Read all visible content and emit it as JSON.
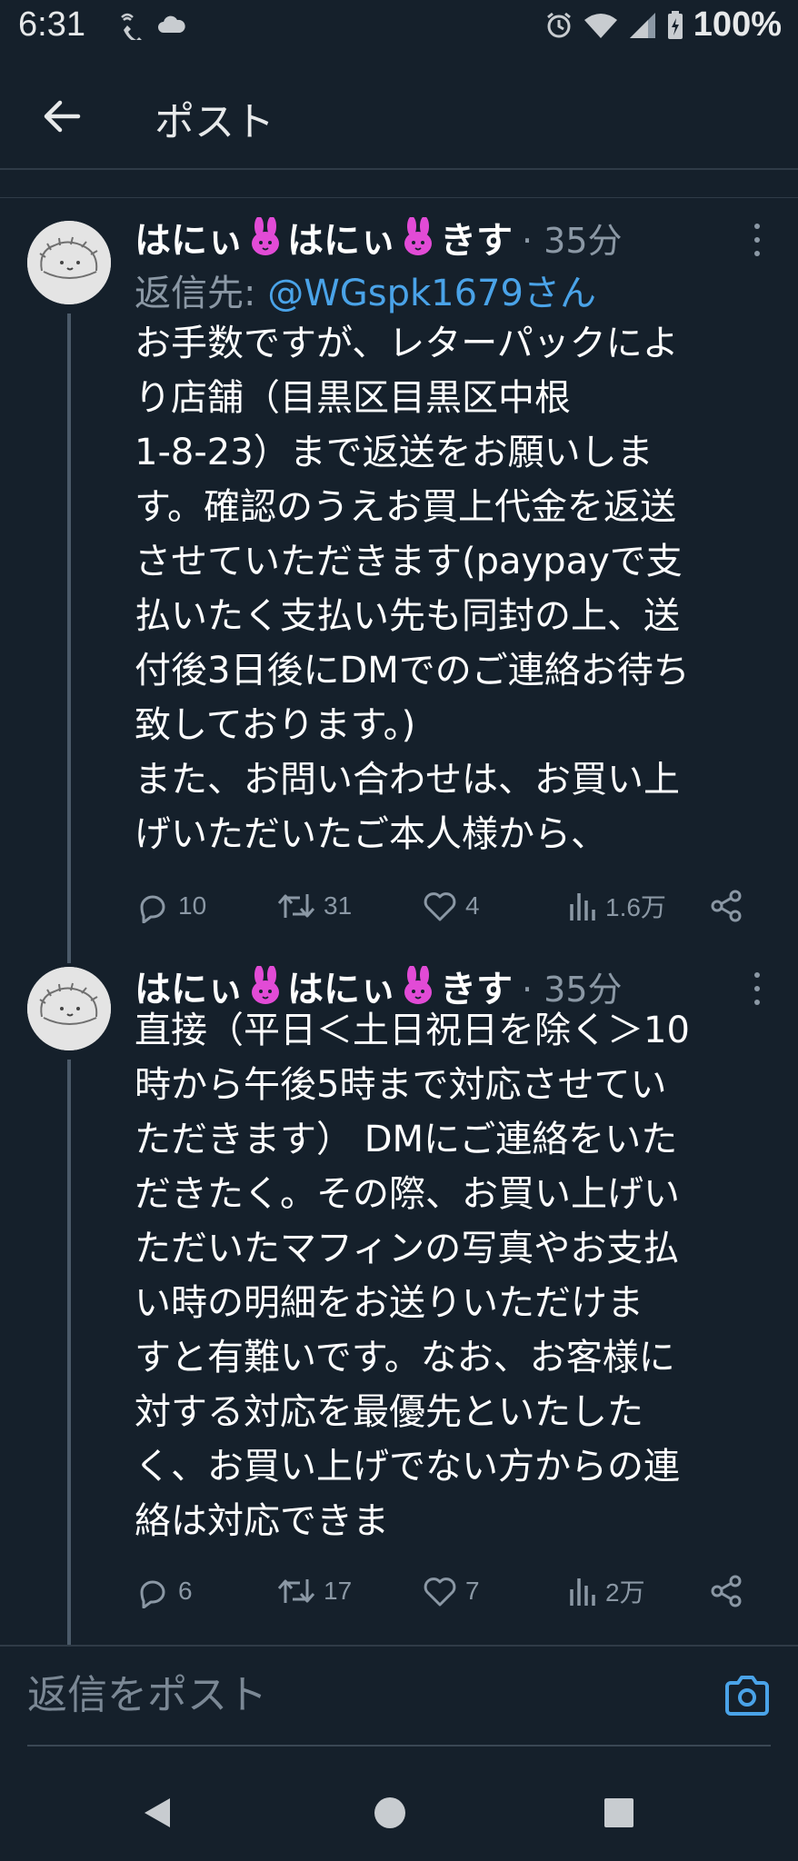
{
  "status_bar": {
    "time": "6:31",
    "battery": "100%",
    "icons": [
      "wifi-call-icon",
      "cloud-icon",
      "alarm-icon",
      "wifi-icon",
      "signal-icon",
      "battery-icon"
    ]
  },
  "header": {
    "title": "ポスト",
    "back_icon": "arrow-left-icon"
  },
  "tweets": [
    {
      "name_part1": "はにぃ",
      "name_part2": "はにぃ",
      "name_part3": "きす",
      "time": "· 35分",
      "reply_to_label": "返信先: ",
      "reply_to_handle": "@WGspk1679さん",
      "text": "お手数ですが、レターパックによ\nり店舗（目黒区目黒区中根\n1-8-23）まで返送をお願いしま\nす。確認のうえお買上代金を返送\nさせていただきます(paypayで支\n払いたく支払い先も同封の上、送\n付後3日後にDMでのご連絡お待ち\n致しております。)\nまた、お問い合わせは、お買い上\nげいただいたご本人様から、",
      "replies": "10",
      "retweets": "31",
      "likes": "4",
      "views": "1.6万"
    },
    {
      "name_part1": "はにぃ",
      "name_part2": "はにぃ",
      "name_part3": "きす",
      "time": "· 35分",
      "text": "直接（平日＜土日祝日を除く＞10\n時から午後5時まで対応させてい\nただきます） DMにご連絡をいた\nだきたく。その際、お買い上げい\nただいたマフィンの写真やお支払\nい時の明細をお送りいただけま\nすと有難いです。なお、お客様に\n対する対応を最優先といたした\nく、お買い上げでない方からの連\n絡は対応できま",
      "replies": "6",
      "retweets": "17",
      "likes": "7",
      "views": "2万"
    }
  ],
  "reply_bar": {
    "placeholder": "返信をポスト",
    "camera_icon": "camera-icon"
  },
  "nav": {
    "icons": [
      "back-triangle-icon",
      "home-circle-icon",
      "recents-square-icon"
    ]
  },
  "colors": {
    "background": "#15202b",
    "accent": "#4aa3e8",
    "muted": "#8b98a5",
    "rabbit": "#e24bd6"
  }
}
